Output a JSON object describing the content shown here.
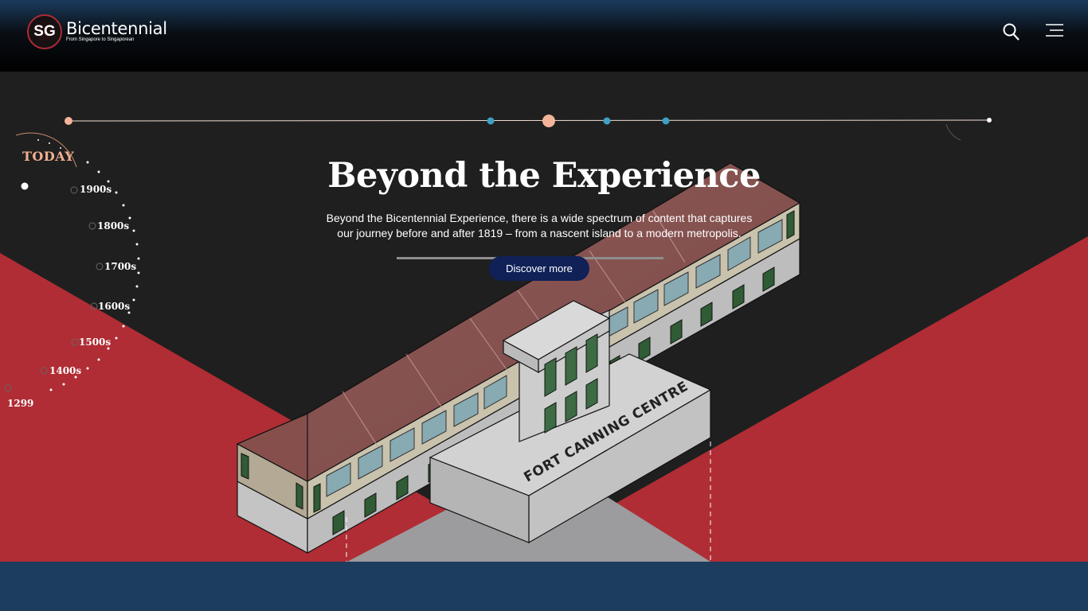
{
  "brand": {
    "badge": "SG",
    "name": "Bicentennial",
    "tagline": "From Singapore to Singaporean"
  },
  "header": {
    "search_icon": "search-icon",
    "menu_icon": "hamburger-menu-icon"
  },
  "timeline": {
    "today_label": "TODAY",
    "eras": [
      "1900s",
      "1800s",
      "1700s",
      "1600s",
      "1500s",
      "1400s",
      "1299"
    ]
  },
  "hero": {
    "title": "Beyond the Experience",
    "description": "Beyond the Bicentennial Experience, there is a wide spectrum of content that captures our journey before and after 1819 – from a nascent island to a modern metropolis.",
    "cta_label": "Discover more"
  },
  "building": {
    "sign": "FORT CANNING CENTRE"
  },
  "colors": {
    "accent_red": "#b02a35",
    "navy_button": "#0f2157",
    "footer_blue": "#1c3d5e",
    "timeline_peach": "#f4b49a",
    "timeline_blue": "#3fa0c2"
  }
}
